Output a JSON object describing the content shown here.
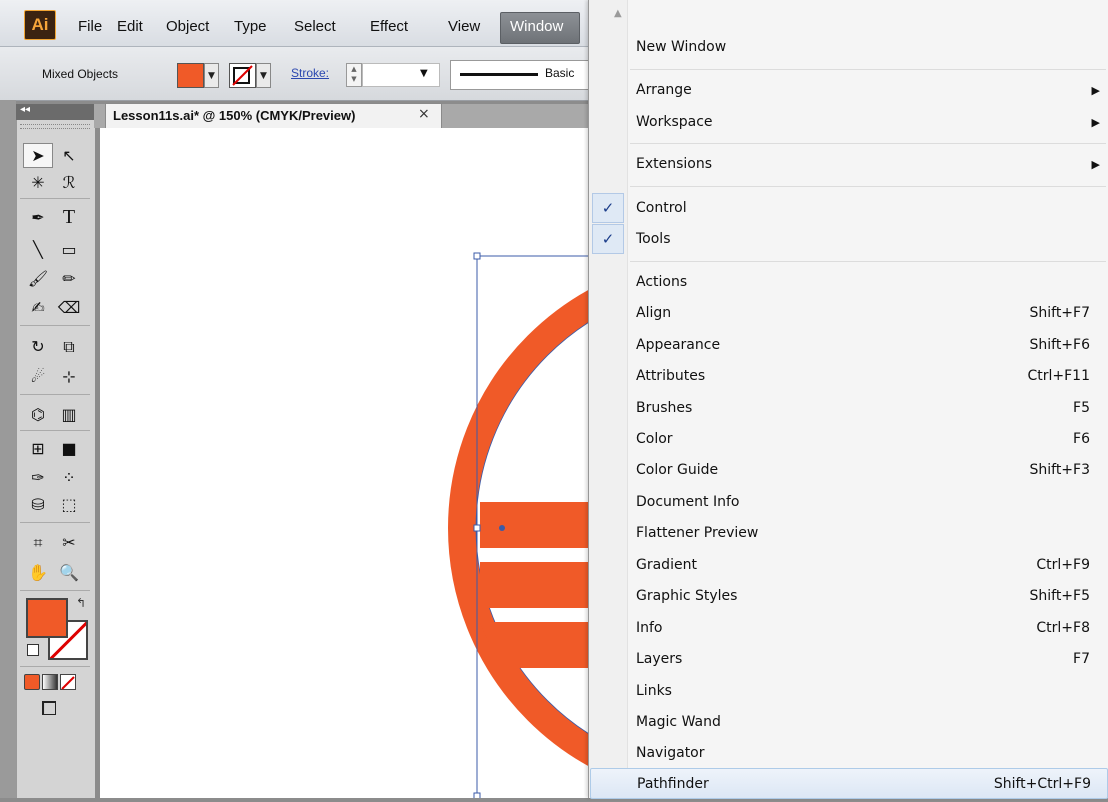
{
  "app": {
    "logo": "Ai",
    "menubar": [
      "File",
      "Edit",
      "Object",
      "Type",
      "Select",
      "Effect",
      "View",
      "Window"
    ]
  },
  "control_bar": {
    "selection_label": "Mixed Objects",
    "stroke_label": "Stroke:",
    "brush_label": "Basic",
    "fill_color": "#f05a28"
  },
  "document": {
    "tab_title": "Lesson11s.ai* @ 150% (CMYK/Preview)",
    "close_glyph": "×"
  },
  "window_menu": {
    "items": [
      {
        "label": "New Window",
        "shortcut": ""
      },
      {
        "label": "Arrange",
        "shortcut": "",
        "submenu": true
      },
      {
        "label": "Workspace",
        "shortcut": "",
        "submenu": true
      },
      {
        "label": "Extensions",
        "shortcut": "",
        "submenu": true
      },
      {
        "label": "Control",
        "shortcut": "",
        "checked": true
      },
      {
        "label": "Tools",
        "shortcut": "",
        "checked": true
      },
      {
        "label": "Actions",
        "shortcut": ""
      },
      {
        "label": "Align",
        "shortcut": "Shift+F7"
      },
      {
        "label": "Appearance",
        "shortcut": "Shift+F6"
      },
      {
        "label": "Attributes",
        "shortcut": "Ctrl+F11"
      },
      {
        "label": "Brushes",
        "shortcut": "F5"
      },
      {
        "label": "Color",
        "shortcut": "F6"
      },
      {
        "label": "Color Guide",
        "shortcut": "Shift+F3"
      },
      {
        "label": "Document Info",
        "shortcut": ""
      },
      {
        "label": "Flattener Preview",
        "shortcut": ""
      },
      {
        "label": "Gradient",
        "shortcut": "Ctrl+F9"
      },
      {
        "label": "Graphic Styles",
        "shortcut": "Shift+F5"
      },
      {
        "label": "Info",
        "shortcut": "Ctrl+F8"
      },
      {
        "label": "Layers",
        "shortcut": "F7"
      },
      {
        "label": "Links",
        "shortcut": ""
      },
      {
        "label": "Magic Wand",
        "shortcut": ""
      },
      {
        "label": "Navigator",
        "shortcut": ""
      },
      {
        "label": "Pathfinder",
        "shortcut": "Shift+Ctrl+F9",
        "highlighted": true
      }
    ]
  },
  "artwork_color": "#f05a28"
}
